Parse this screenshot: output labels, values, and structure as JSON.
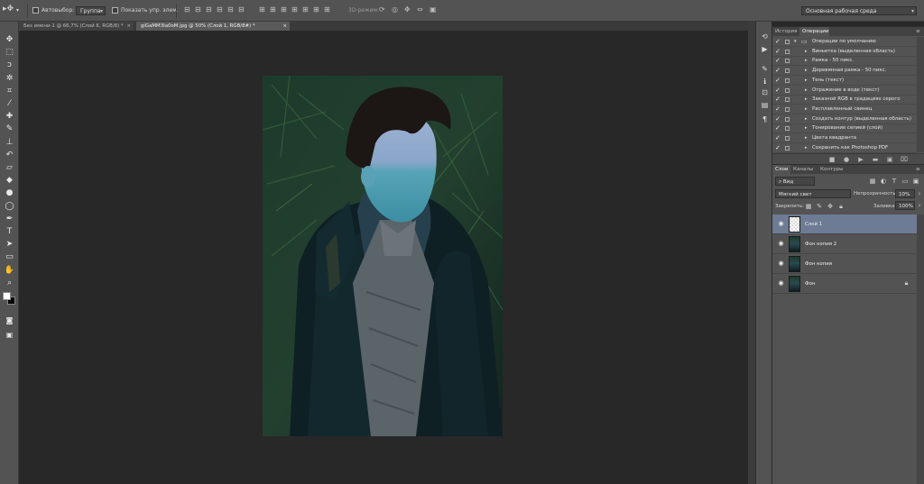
{
  "options_bar": {
    "auto_select_label": "Автовыбор:",
    "auto_select_value": "Группа",
    "show_transform_label": "Показать упр. элем.",
    "mode_3d_label": "3D-режим:",
    "workspace_value": "Основная рабочая среда"
  },
  "document_tabs": [
    {
      "label": "Без имени-1 @ 66,7% (Слой 6, RGB/8) *"
    },
    {
      "label": "giGaMM3Ia0oM.jpg @ 50% (Слой 1, RGB/8#) *"
    }
  ],
  "toolbar": {
    "tools": [
      {
        "icon": "move-icon",
        "glyph": "✥"
      },
      {
        "icon": "marquee-icon",
        "glyph": "⬚"
      },
      {
        "icon": "lasso-icon",
        "glyph": "ↄ"
      },
      {
        "icon": "magic-wand-icon",
        "glyph": "✲"
      },
      {
        "icon": "crop-icon",
        "glyph": "⌗"
      },
      {
        "icon": "eyedropper-icon",
        "glyph": "⁄"
      },
      {
        "icon": "healing-brush-icon",
        "glyph": "✚"
      },
      {
        "icon": "brush-icon",
        "glyph": "✎"
      },
      {
        "icon": "clone-stamp-icon",
        "glyph": "⊥"
      },
      {
        "icon": "history-brush-icon",
        "glyph": "↶"
      },
      {
        "icon": "eraser-icon",
        "glyph": "▱"
      },
      {
        "icon": "paint-bucket-icon",
        "glyph": "◆"
      },
      {
        "icon": "blur-icon",
        "glyph": "●"
      },
      {
        "icon": "dodge-icon",
        "glyph": "◯"
      },
      {
        "icon": "pen-icon",
        "glyph": "✒"
      },
      {
        "icon": "type-icon",
        "glyph": "T"
      },
      {
        "icon": "path-selection-icon",
        "glyph": "➤"
      },
      {
        "icon": "rectangle-shape-icon",
        "glyph": "▭"
      },
      {
        "icon": "hand-icon",
        "glyph": "✋"
      },
      {
        "icon": "zoom-icon",
        "glyph": "⌕"
      }
    ]
  },
  "panel_icons": [
    {
      "icon": "history-icon",
      "glyph": "⟲"
    },
    {
      "icon": "actions-play-icon",
      "glyph": "▶"
    },
    {
      "icon": "brush-preset-icon",
      "glyph": "✎"
    },
    {
      "icon": "info-icon",
      "glyph": "ℹ"
    },
    {
      "icon": "navigator-icon",
      "glyph": "⊡"
    },
    {
      "icon": "layer-comps-icon",
      "glyph": "▤"
    },
    {
      "icon": "paragraph-icon",
      "glyph": "¶"
    }
  ],
  "actions_panel": {
    "tabs": [
      "История",
      "Операции"
    ],
    "active_tab": 1,
    "items": [
      {
        "label": "Операции по умолчанию",
        "level": 0
      },
      {
        "label": "Виньетка (выделенная область)",
        "level": 1
      },
      {
        "label": "Рамка - 50 пикс.",
        "level": 1
      },
      {
        "label": "Деревянная рамка - 50 пикс.",
        "level": 1
      },
      {
        "label": "Тень (текст)",
        "level": 1
      },
      {
        "label": "Отражение в воде (текст)",
        "level": 1
      },
      {
        "label": "Заказной RGB в градациях серого",
        "level": 1
      },
      {
        "label": "Расплавленный свинец",
        "level": 1
      },
      {
        "label": "Создать контур (выделенная область)",
        "level": 1
      },
      {
        "label": "Тонирование сепией (слой)",
        "level": 1
      },
      {
        "label": "Цвета квадранта",
        "level": 1
      },
      {
        "label": "Сохранить как Photoshop PDF",
        "level": 1
      }
    ]
  },
  "layers_panel": {
    "tabs": [
      "Слои",
      "Каналы",
      "Контуры"
    ],
    "active_tab": 0,
    "filter_kind": "Вид",
    "blend_mode": "Мягкий свет",
    "opacity_label": "Непрозрачность:",
    "opacity_value": "10%",
    "lock_label": "Закрепить:",
    "fill_label": "Заливка:",
    "fill_value": "100%",
    "layers": [
      {
        "name": "Слой 1",
        "selected": true,
        "locked": false
      },
      {
        "name": "Фон копия 2",
        "selected": false,
        "locked": false
      },
      {
        "name": "Фон копия",
        "selected": false,
        "locked": false
      },
      {
        "name": "Фон",
        "selected": false,
        "locked": true
      }
    ]
  }
}
